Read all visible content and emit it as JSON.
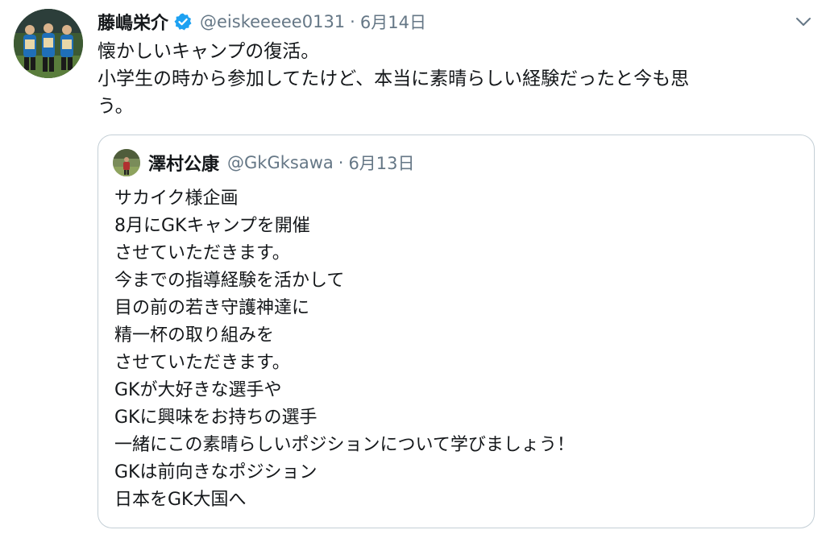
{
  "tweet": {
    "author_name": "藤嶋栄介",
    "author_handle": "@eiskeeeee0131",
    "separator": "·",
    "date": "6月14日",
    "text_line1": "懐かしいキャンプの復活。",
    "text_line2": "小学生の時から参加してたけど、本当に素晴らしい経験だったと今も思",
    "text_line3": "う。"
  },
  "quoted": {
    "author_name": "澤村公康",
    "author_handle": "@GkGksawa",
    "separator": "·",
    "date": "6月13日",
    "lines": [
      "サカイク様企画",
      "8月にGKキャンプを開催",
      "させていただきます。",
      "今までの指導経験を活かして",
      "目の前の若き守護神達に",
      "精一杯の取り組みを",
      "させていただきます。",
      "GKが大好きな選手や",
      "GKに興味をお持ちの選手",
      "一緒にこの素晴らしいポジションについて学びましょう！",
      "GKは前向きなポジション",
      "日本をGK大国へ"
    ]
  },
  "colors": {
    "text": "#14171a",
    "secondary": "#657786",
    "verified": "#1da1f2",
    "border": "#c4cfd6"
  },
  "icons": {
    "verified": "verified-badge-icon",
    "menu": "chevron-down-icon"
  }
}
